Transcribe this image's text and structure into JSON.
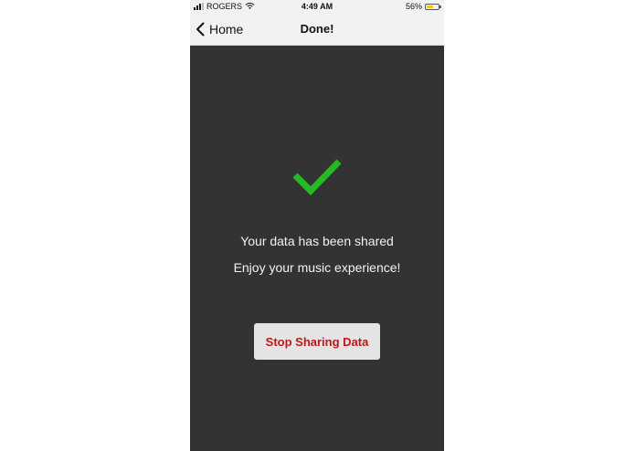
{
  "status_bar": {
    "carrier": "ROGERS",
    "time": "4:49 AM",
    "battery_percent": "56%",
    "battery_level": 0.56,
    "signal_bars": 3,
    "signal_max": 4
  },
  "nav": {
    "back_label": "Home",
    "title": "Done!"
  },
  "main": {
    "success_icon": "checkmark-icon",
    "success_color": "#22bb22",
    "message_line1": "Your data has been shared",
    "message_line2": "Enjoy your music experience!",
    "stop_button_label": "Stop Sharing Data",
    "stop_button_color": "#c0161b"
  }
}
